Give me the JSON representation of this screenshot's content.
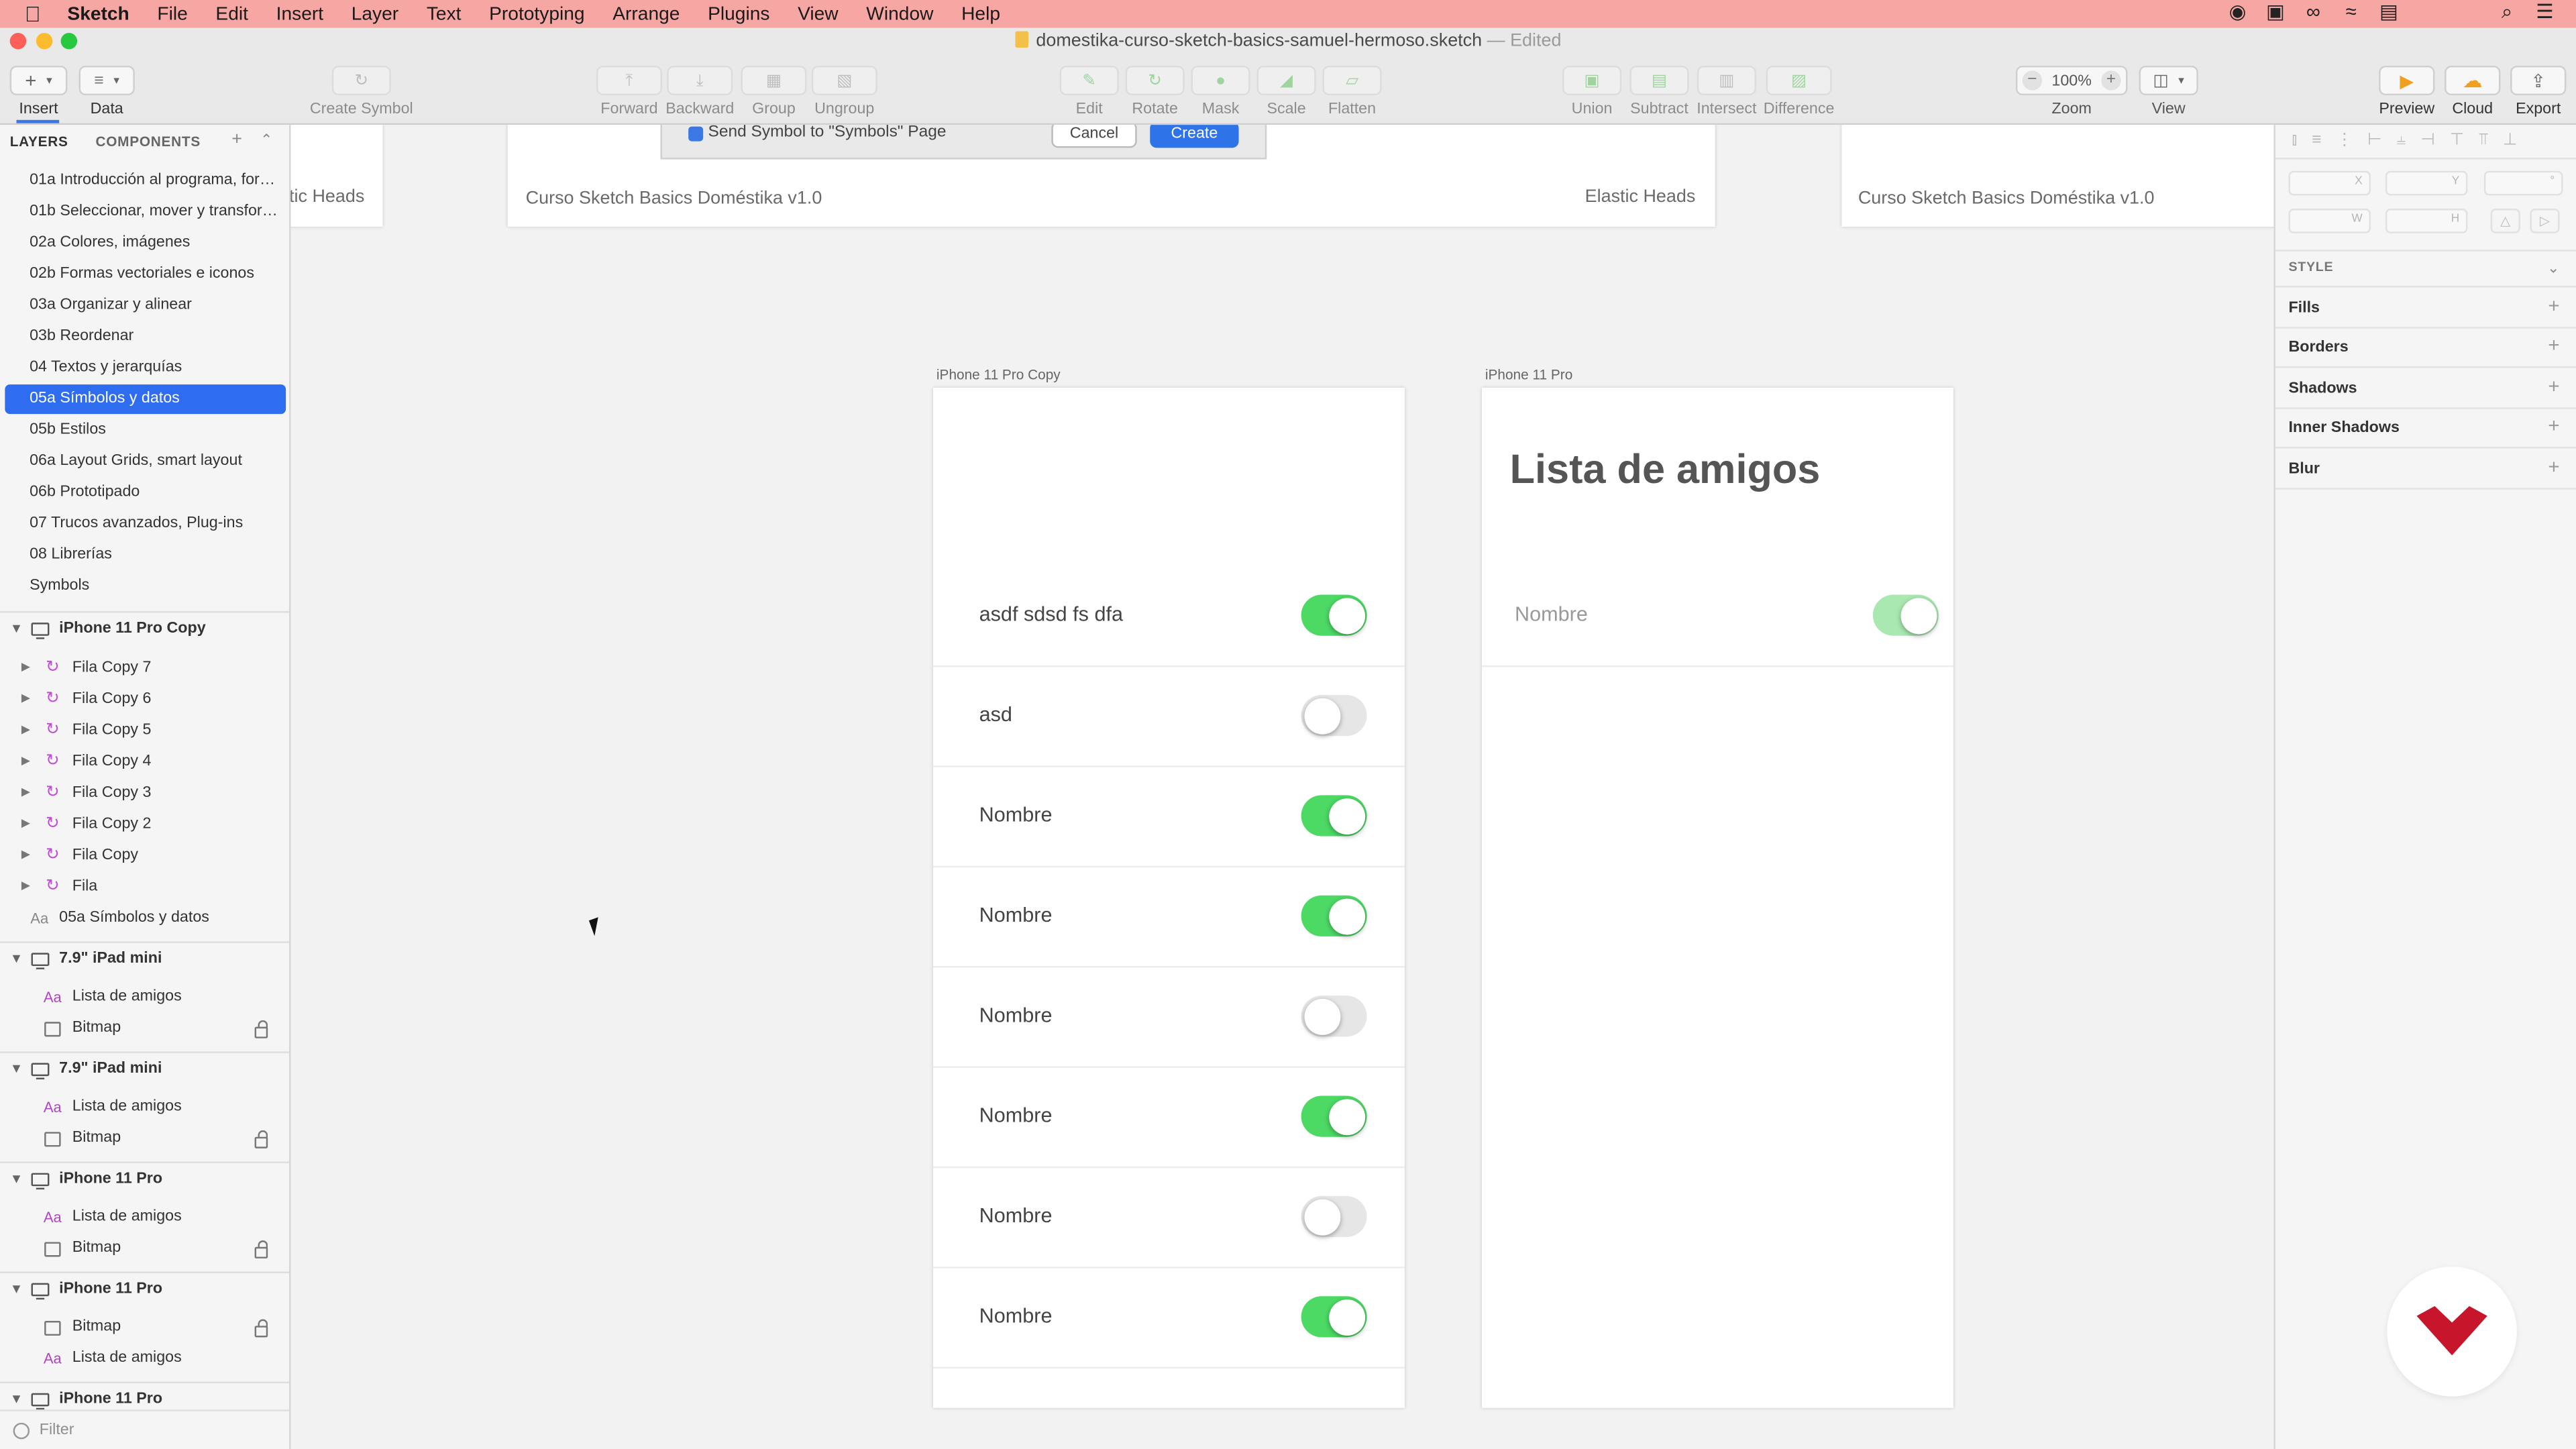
{
  "menubar": {
    "app": "Sketch",
    "items": [
      "File",
      "Edit",
      "Insert",
      "Layer",
      "Text",
      "Prototyping",
      "Arrange",
      "Plugins",
      "View",
      "Window",
      "Help"
    ],
    "status_icons": [
      "record-icon",
      "screen-icon",
      "creative-cloud-icon",
      "wifi-icon",
      "menu-extra-icon",
      "search-icon",
      "list-icon"
    ]
  },
  "window": {
    "title": "domestika-curso-sketch-basics-samuel-hermoso.sketch",
    "edited": "— Edited"
  },
  "toolbar": {
    "insert": "Insert",
    "data": "Data",
    "create_symbol": "Create Symbol",
    "forward": "Forward",
    "backward": "Backward",
    "group": "Group",
    "ungroup": "Ungroup",
    "edit": "Edit",
    "rotate": "Rotate",
    "mask": "Mask",
    "scale": "Scale",
    "flatten": "Flatten",
    "union": "Union",
    "subtract": "Subtract",
    "intersect": "Intersect",
    "difference": "Difference",
    "zoom_value": "100%",
    "zoom": "Zoom",
    "view": "View",
    "preview": "Preview",
    "cloud": "Cloud",
    "export": "Export",
    "colors": {
      "accent": "#3a78e6",
      "preview_icon": "#f0a020",
      "cloud_icon": "#f0a020"
    }
  },
  "sidebar": {
    "tabs": {
      "layers": "LAYERS",
      "components": "COMPONENTS"
    },
    "pages": [
      "01a Introducción al programa, form...",
      "01b Seleccionar, mover y transformar",
      "02a Colores, imágenes",
      "02b Formas vectoriales e iconos",
      "03a Organizar y alinear",
      "03b Reordenar",
      "04 Textos y jerarquías",
      "05a Símbolos y datos",
      "05b Estilos",
      "06a Layout Grids, smart layout",
      "06b Prototipado",
      "07 Trucos avanzados, Plug-ins",
      "08 Librerías",
      "Symbols"
    ],
    "selected_page": "05a Símbolos y datos",
    "groups": {
      "g1": "iPhone 11 Pro Copy",
      "g1_layers": [
        "Fila Copy 7",
        "Fila Copy 6",
        "Fila Copy 5",
        "Fila Copy 4",
        "Fila Copy 3",
        "Fila Copy 2",
        "Fila Copy",
        "Fila",
        "05a Símbolos y datos"
      ],
      "g2": "7.9\" iPad mini",
      "g2_layers": [
        "Lista de amigos",
        "Bitmap"
      ],
      "g3": "7.9\" iPad mini",
      "g3_layers": [
        "Lista de amigos",
        "Bitmap"
      ],
      "g4": "iPhone 11 Pro",
      "g4_layers": [
        "Lista de amigos",
        "Bitmap"
      ],
      "g5": "iPhone 11 Pro",
      "g5_layers": [
        "Bitmap",
        "Lista de amigos"
      ],
      "g6": "iPhone 11 Pro"
    },
    "filter_placeholder": "Filter"
  },
  "canvas": {
    "slides": {
      "left_text": "tic Heads",
      "mid_left": "Curso Sketch Basics Doméstika v1.0",
      "mid_right": "Elastic Heads",
      "right_text": "Curso Sketch Basics Doméstika v1.0"
    },
    "dialog": {
      "text": "Send Symbol to \"Symbols\" Page",
      "cancel": "Cancel",
      "create": "Create"
    },
    "artboard1": {
      "label": "iPhone 11 Pro Copy",
      "rows": [
        {
          "text": "asdf sdsd fs dfa",
          "state": "on"
        },
        {
          "text": "asd",
          "state": "off"
        },
        {
          "text": "Nombre",
          "state": "on"
        },
        {
          "text": "Nombre",
          "state": "on"
        },
        {
          "text": "Nombre",
          "state": "off"
        },
        {
          "text": "Nombre",
          "state": "on"
        },
        {
          "text": "Nombre",
          "state": "off"
        },
        {
          "text": "Nombre",
          "state": "on"
        }
      ]
    },
    "artboard2": {
      "label": "iPhone 11 Pro",
      "title": "Lista de amigos",
      "row_text": "Nombre"
    },
    "colors": {
      "toggle_on": "#4cd964",
      "toggle_off": "#e6e6e6"
    }
  },
  "inspector": {
    "fields": {
      "x": "X",
      "y": "Y",
      "w": "W",
      "h": "H"
    },
    "style_header": "STYLE",
    "sections": [
      "Fills",
      "Borders",
      "Shadows",
      "Inner Shadows",
      "Blur"
    ],
    "logo_color": "#c7162b"
  }
}
